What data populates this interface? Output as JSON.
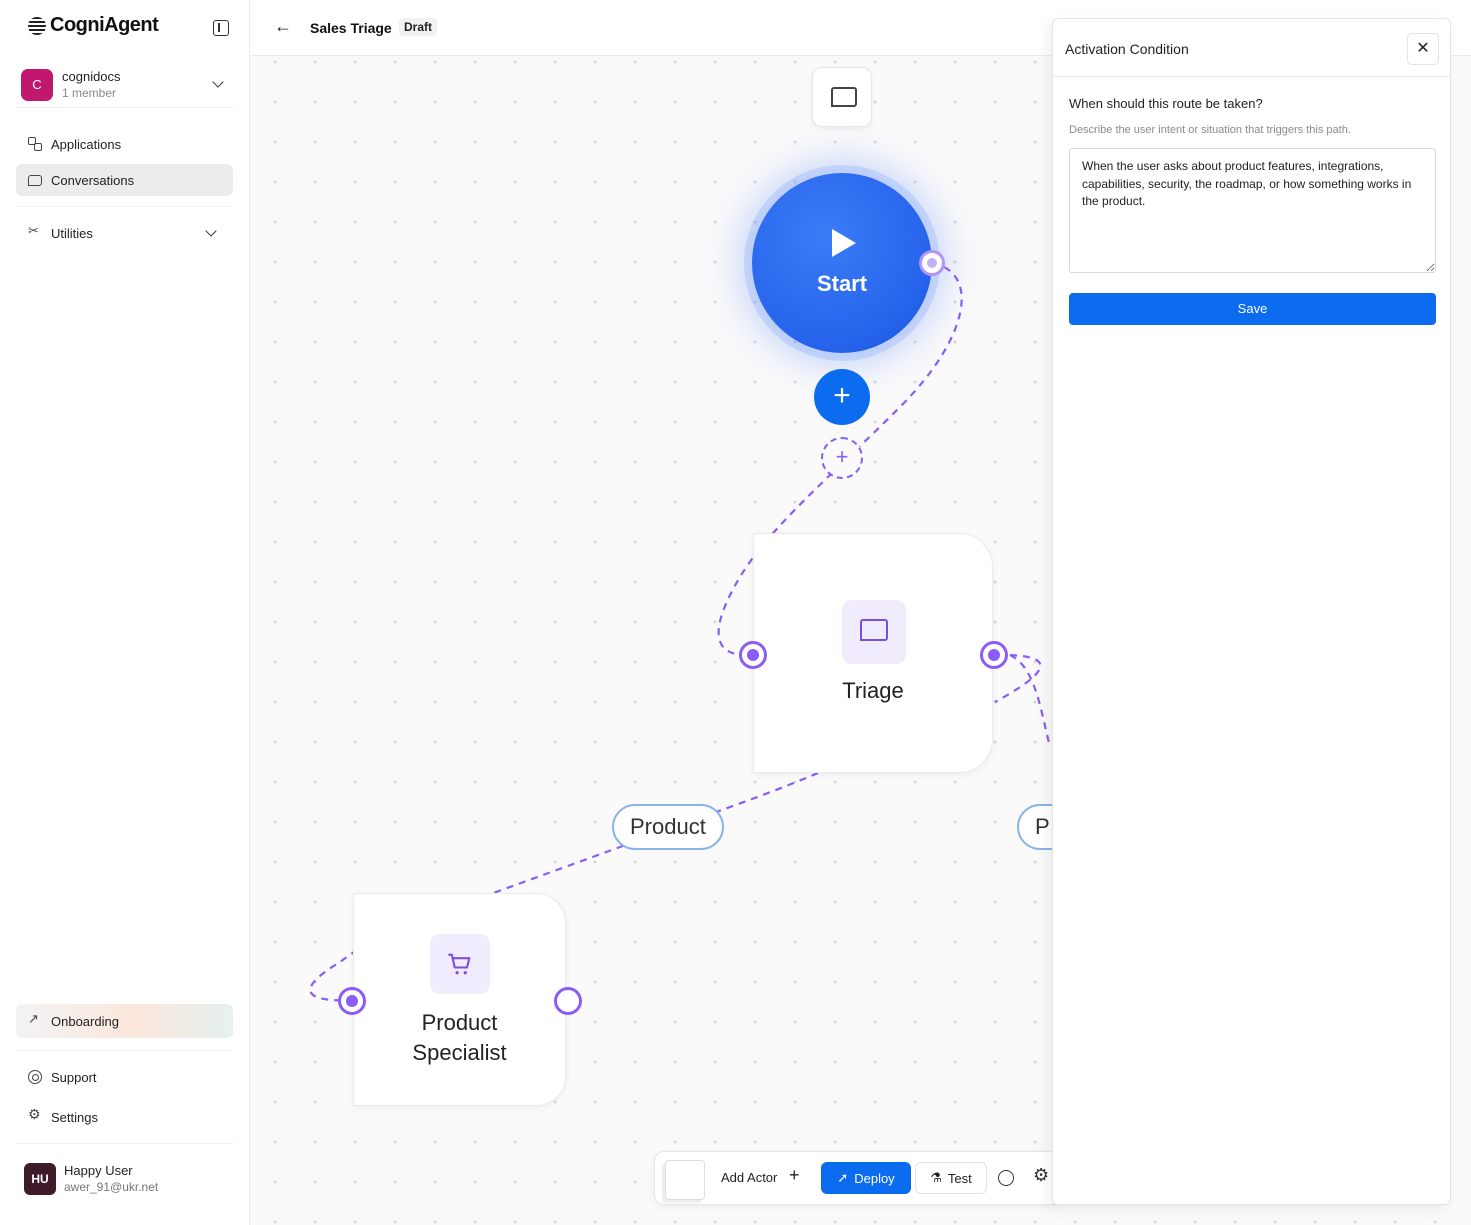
{
  "app": {
    "logo": "CogniAgent"
  },
  "org": {
    "initial": "C",
    "name": "cognidocs",
    "members": "1 member"
  },
  "sidebar": {
    "items": [
      {
        "label": "Applications"
      },
      {
        "label": "Conversations"
      },
      {
        "label": "Utilities"
      }
    ],
    "bottom": [
      {
        "label": "Onboarding"
      },
      {
        "label": "Support"
      },
      {
        "label": "Settings"
      }
    ]
  },
  "user": {
    "initials": "HU",
    "name": "Happy User",
    "email": "awer_91@ukr.net"
  },
  "header": {
    "title": "Sales Triage",
    "status": "Draft"
  },
  "canvas": {
    "start_label": "Start",
    "nodes": [
      {
        "label": "Triage",
        "icon": "message-icon"
      },
      {
        "label": "Product\nSpecialist",
        "icon": "cart-icon"
      }
    ],
    "routes": [
      "Product",
      "P"
    ]
  },
  "toolbar": {
    "add_actor": "Add Actor",
    "deploy": "Deploy",
    "test": "Test"
  },
  "panel": {
    "title": "Activation Condition",
    "question": "When should this route be taken?",
    "help": "Describe the user intent or situation that triggers this path.",
    "condition": "When the user asks about product features, integrations, capabilities, security, the roadmap, or how something works in the product.",
    "save": "Save"
  },
  "colors": {
    "accent": "#0b6cf0",
    "edge": "#8b5cf6",
    "start": "#2563eb",
    "org_avatar": "#c0186e"
  }
}
